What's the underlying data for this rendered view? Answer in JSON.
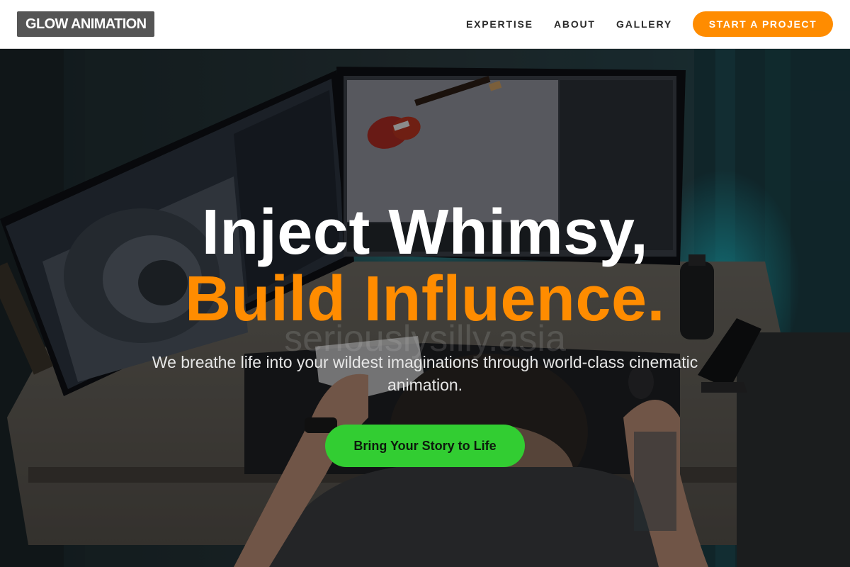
{
  "brand": {
    "logo_text": "GLOW ANIMATION"
  },
  "nav": {
    "items": [
      {
        "label": "EXPERTISE"
      },
      {
        "label": "ABOUT"
      },
      {
        "label": "GALLERY"
      }
    ],
    "cta_label": "START A PROJECT"
  },
  "hero": {
    "headline_line1": "Inject Whimsy,",
    "headline_line2": "Build Influence.",
    "watermark": "seriouslysilly.asia",
    "subtext": "We breathe life into your wildest imaginations through world-class cinematic animation.",
    "button_label": "Bring Your Story to Life",
    "background_icon": "photo-workstation-with-dual-monitors"
  },
  "colors": {
    "accent_orange": "#FF8C00",
    "accent_green": "#32CD32",
    "logo_bg": "#555555",
    "nav_text": "#2A2A2A"
  }
}
